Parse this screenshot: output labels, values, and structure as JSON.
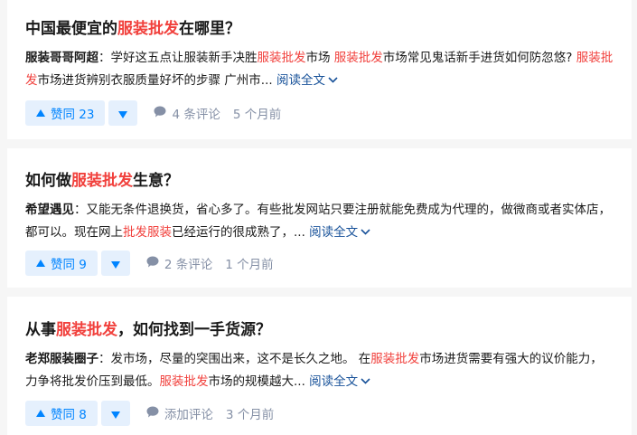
{
  "colors": {
    "highlight": "#f1403c",
    "link": "#175199",
    "vote": "#0084ff",
    "vote_bg": "#e5f0fd",
    "meta": "#8590a6"
  },
  "icons": {
    "vote_up": "triangle-up-icon",
    "vote_down": "triangle-down-icon",
    "comment": "comment-bubble-icon",
    "expand": "chevron-down-icon"
  },
  "cards": [
    {
      "title": {
        "pre": "中国最便宜的",
        "hl": "服装批发",
        "post": "在哪里？"
      },
      "excerpt": {
        "author": "服装哥哥阿超",
        "sep": "：",
        "t1": "学好这五点让服装新手决胜",
        "h1": "服装批发",
        "t2": "市场 ",
        "h2": "服装批发",
        "t3": "市场常见鬼话新手进货如何防忽悠? ",
        "h3": "服装批发",
        "t4": "市场进货辨别衣服质量好坏的步骤 广州市... "
      },
      "read_more": "阅读全文",
      "vote_up": "赞同 23",
      "comments": "4 条评论",
      "time": "5 个月前"
    },
    {
      "title": {
        "pre": "如何做",
        "hl": "服装批发",
        "post": "生意？"
      },
      "excerpt": {
        "author": "希望遇见",
        "sep": "：",
        "t1": "又能无条件退换货，省心多了。有些批发网站只要注册就能免费成为代理的，做微商或者实体店，都可以。现在网上",
        "h1": "批发服装",
        "t2": "已经运行的很成熟了，... "
      },
      "read_more": "阅读全文",
      "vote_up": "赞同 9",
      "comments": "2 条评论",
      "time": "1 个月前"
    },
    {
      "title": {
        "pre": "从事",
        "hl": "服装批发",
        "post": "，如何找到一手货源？"
      },
      "excerpt": {
        "author": "老郑服装圈子",
        "sep": "：",
        "t1": "发市场，尽量的突围出来，这不是长久之地。 在",
        "h1": "服装批发",
        "t2": "市场进货需要有强大的议价能力，力争将批发价压到最低。",
        "h2": "服装批发",
        "t3": "市场的规模越大... "
      },
      "read_more": "阅读全文",
      "vote_up": "赞同 8",
      "comments": "添加评论",
      "time": "3 个月前"
    }
  ]
}
